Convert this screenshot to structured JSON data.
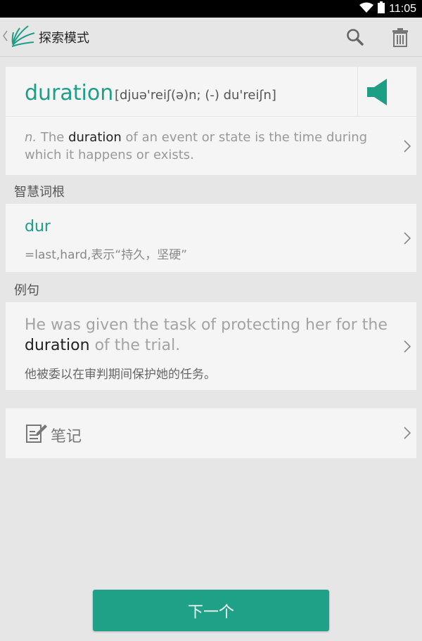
{
  "status_bar": {
    "time": "11:05"
  },
  "app_bar": {
    "title": "探索模式"
  },
  "word_card": {
    "word": "duration",
    "phonetic": "[djuə'reiʃ(ə)n; (-) du'reiʃn]",
    "definition": {
      "pos": "n.",
      "before": " The ",
      "highlight": "duration",
      "after": " of an event or state is the time during which it happens or exists."
    }
  },
  "root_section": {
    "label": "智慧词根",
    "root": "dur",
    "meaning": "=last,hard,表示“持久，坚硬”"
  },
  "example_section": {
    "label": "例句",
    "en_before": "He was given the task of protecting her for the ",
    "en_highlight": "duration",
    "en_after": " of the trial.",
    "zh": "他被委以在审判期间保护她的任务。"
  },
  "notes": {
    "label": "笔记"
  },
  "next_button": {
    "label": "下一个"
  },
  "colors": {
    "accent": "#1fa187",
    "word": "#1e9e85",
    "background": "#e6e6e6",
    "card": "#f5f5f5"
  }
}
